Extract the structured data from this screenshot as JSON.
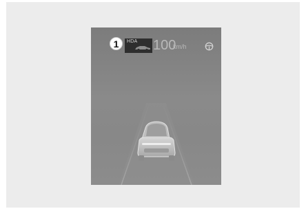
{
  "cluster": {
    "callout_number": "1",
    "hda_label": "HDA",
    "speed_value": "100",
    "speed_unit": "km/h"
  },
  "icons": {
    "hda_car": "car-silhouette-icon",
    "steering": "steering-wheel-icon",
    "front_vehicle": "front-vehicle-icon"
  },
  "colors": {
    "screen_bg": "#888888",
    "hda_bg": "#2e2e2e",
    "speed_text": "#b9b9b9"
  }
}
